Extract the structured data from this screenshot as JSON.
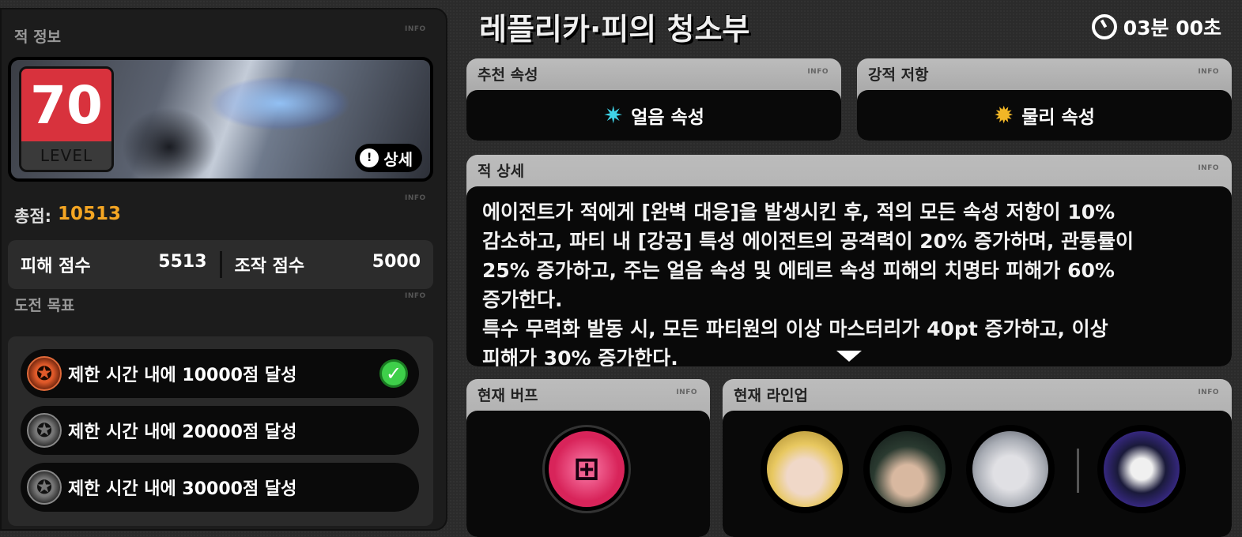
{
  "left": {
    "enemy_info_title": "적 정보",
    "info_tag": "INFO",
    "level": "70",
    "level_label": "LEVEL",
    "detail_label": "상세",
    "total_label": "총점:",
    "total_value": "10513",
    "damage_label": "피해 점수",
    "damage_value": "5513",
    "control_label": "조작 점수",
    "control_value": "5000",
    "goals_title": "도전 목표",
    "goals": [
      {
        "text": "제한 시간 내에 10000점 달성",
        "done": true
      },
      {
        "text": "제한 시간 내에 20000점 달성",
        "done": false
      },
      {
        "text": "제한 시간 내에 30000점 달성",
        "done": false
      }
    ]
  },
  "header": {
    "stage_title": "레플리카·피의 청소부",
    "timer": "03분 00초"
  },
  "recommend": {
    "title": "추천 속성",
    "value": "얼음 속성",
    "color": "#3fd4e8"
  },
  "resist": {
    "title": "강적 저항",
    "value": "물리 속성",
    "color": "#f2b626"
  },
  "detail": {
    "title": "적 상세",
    "lines": [
      "에이전트가 적에게 [완벽 대응]을 발생시킨 후, 적의 모든 속성 저항이 10%",
      "감소하고, 파티 내 [강공] 특성 에이전트의 공격력이 20% 증가하며, 관통률이",
      "25% 증가하고, 주는 얼음 속성 및 에테르 속성 피해의 치명타 피해가 60%",
      "증가한다.",
      "특수 무력화 발동 시, 모든 파티원의 이상 마스터리가 40pt 증가하고, 이상",
      "피해가 30% 증가한다."
    ]
  },
  "buff": {
    "title": "현재 버프"
  },
  "lineup": {
    "title": "현재 라인업"
  }
}
